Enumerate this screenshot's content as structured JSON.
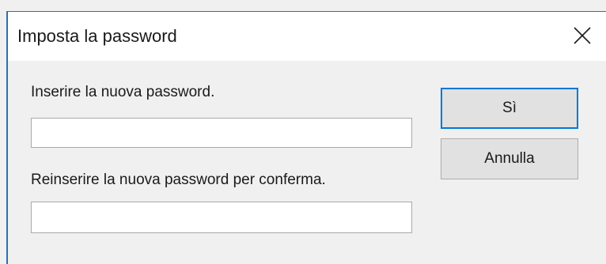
{
  "dialog": {
    "title": "Imposta la password",
    "close_icon": "close-icon"
  },
  "form": {
    "new_password_label": "Inserire la nuova password.",
    "new_password_value": "",
    "confirm_password_label": "Reinserire la nuova password per conferma.",
    "confirm_password_value": ""
  },
  "buttons": {
    "ok_label": "Sì",
    "cancel_label": "Annulla"
  },
  "colors": {
    "accent": "#0078d7",
    "window_frame": "#2b6fb2",
    "background": "#f0f0f0"
  }
}
